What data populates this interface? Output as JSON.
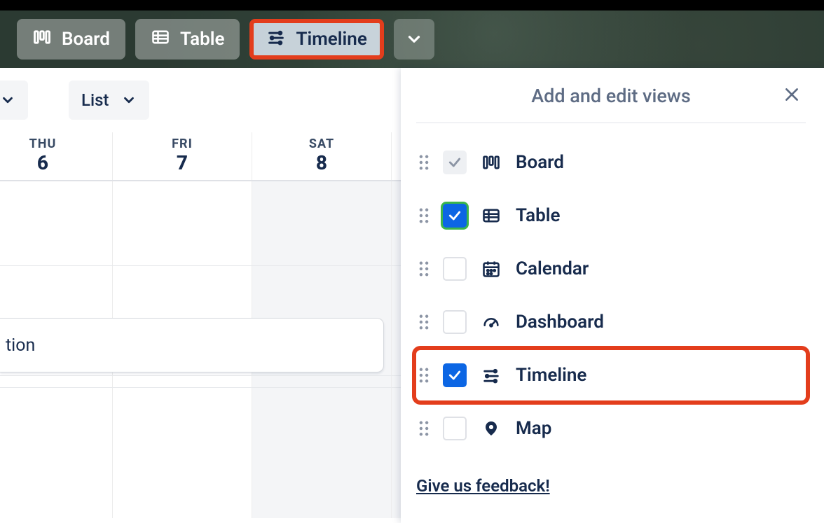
{
  "tabs": {
    "board": "Board",
    "table": "Table",
    "timeline": "Timeline"
  },
  "toolbar": {
    "list": "List"
  },
  "days": [
    {
      "dow": "THU",
      "num": "6"
    },
    {
      "dow": "FRI",
      "num": "7"
    },
    {
      "dow": "SAT",
      "num": "8"
    }
  ],
  "event_partial": "tion",
  "panel": {
    "title": "Add and edit views",
    "views": [
      {
        "key": "board",
        "label": "Board",
        "checked": "disabled"
      },
      {
        "key": "table",
        "label": "Table",
        "checked": "yes-outlined"
      },
      {
        "key": "calendar",
        "label": "Calendar",
        "checked": "no"
      },
      {
        "key": "dashboard",
        "label": "Dashboard",
        "checked": "no"
      },
      {
        "key": "timeline",
        "label": "Timeline",
        "checked": "yes"
      },
      {
        "key": "map",
        "label": "Map",
        "checked": "no"
      }
    ],
    "feedback": "Give us feedback!"
  }
}
